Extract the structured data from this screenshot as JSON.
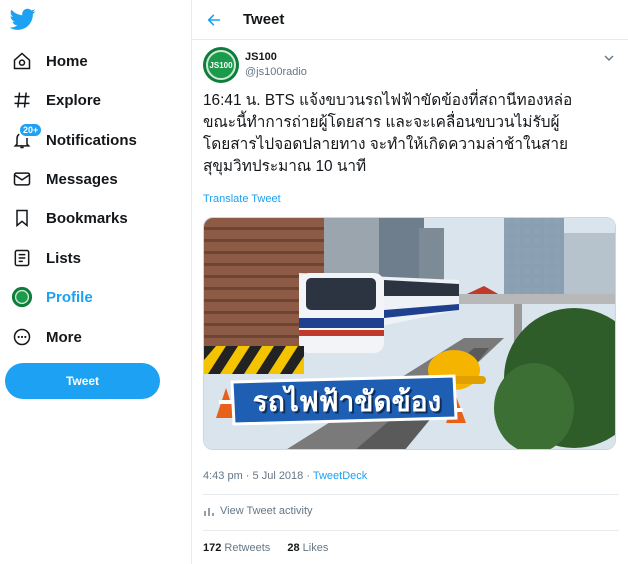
{
  "sidebar": {
    "logo": "twitter-bird-icon",
    "items": [
      {
        "label": "Home",
        "icon": "home-icon"
      },
      {
        "label": "Explore",
        "icon": "hashtag-icon"
      },
      {
        "label": "Notifications",
        "icon": "bell-icon",
        "badge": "20+"
      },
      {
        "label": "Messages",
        "icon": "envelope-icon"
      },
      {
        "label": "Bookmarks",
        "icon": "bookmark-icon"
      },
      {
        "label": "Lists",
        "icon": "list-icon"
      },
      {
        "label": "Profile",
        "icon": "profile-avatar",
        "active": true
      },
      {
        "label": "More",
        "icon": "more-circle-icon"
      }
    ],
    "tweet_button": "Tweet"
  },
  "header": {
    "title": "Tweet",
    "back_icon": "back-arrow-icon"
  },
  "tweet": {
    "author_name": "JS100",
    "author_handle": "@js100radio",
    "avatar_text": "JS100",
    "text": "16:41 น. BTS แจ้งขบวนรถไฟฟ้าขัดข้องที่สถานีทองหล่อ ขณะนี้ทำการถ่ายผู้โดยสาร และจะเคลื่อนขบวนไม่รับผู้โดยสารไปจอดปลายทาง จะทำให้เกิดความล่าช้าในสายสุขุมวิทประมาณ 10 นาที",
    "translate": "Translate Tweet",
    "image_caption": "รถไฟฟ้าขัดข้อง",
    "time": "4:43 pm · 5 Jul 2018 · ",
    "source": "TweetDeck",
    "activity": "View Tweet activity",
    "retweets_count": "172",
    "retweets_label": "Retweets",
    "likes_count": "28",
    "likes_label": "Likes"
  },
  "colors": {
    "accent": "#1da1f2",
    "text": "#14171a",
    "muted": "#657786",
    "border": "#e6ecf0"
  }
}
